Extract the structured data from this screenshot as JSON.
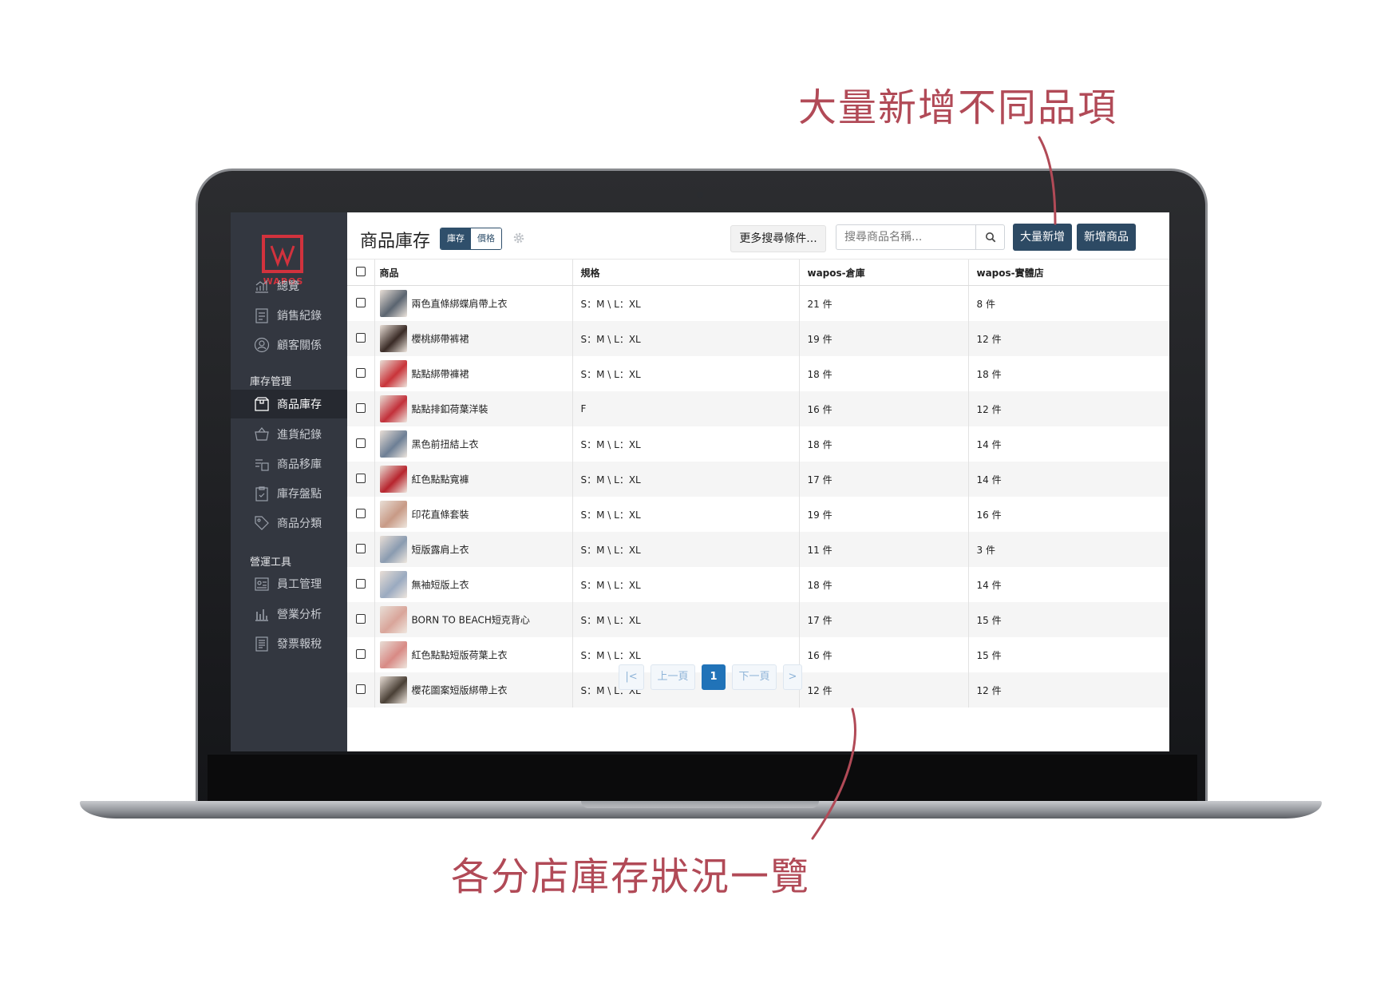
{
  "annotations": {
    "top": "大量新增不同品項",
    "bottom": "各分店庫存狀況一覽"
  },
  "sidebar": {
    "logo_text": "WAPOS",
    "items_top": [
      {
        "label": "總覽",
        "icon": "chart-icon"
      },
      {
        "label": "銷售紀錄",
        "icon": "receipt-icon"
      },
      {
        "label": "顧客關係",
        "icon": "customer-icon"
      }
    ],
    "section_inventory": "庫存管理",
    "items_inventory": [
      {
        "label": "商品庫存",
        "icon": "box-icon",
        "active": true
      },
      {
        "label": "進貨紀錄",
        "icon": "cart-icon"
      },
      {
        "label": "商品移庫",
        "icon": "transfer-icon"
      },
      {
        "label": "庫存盤點",
        "icon": "clipboard-icon"
      },
      {
        "label": "商品分類",
        "icon": "tag-icon"
      }
    ],
    "section_tools": "營運工具",
    "items_tools": [
      {
        "label": "員工管理",
        "icon": "employee-icon"
      },
      {
        "label": "營業分析",
        "icon": "bar-chart-icon"
      },
      {
        "label": "發票報稅",
        "icon": "invoice-icon"
      }
    ]
  },
  "header": {
    "title": "商品庫存",
    "toggle_on": "庫存",
    "toggle_off": "價格",
    "more_filters": "更多搜尋條件...",
    "search_placeholder": "搜尋商品名稱...",
    "bulk_add": "大量新增",
    "add_product": "新增商品"
  },
  "table": {
    "columns": [
      "商品",
      "規格",
      "wapos-倉庫",
      "wapos-實體店"
    ],
    "rows": [
      {
        "name": "兩色直條綁蝶肩帶上衣",
        "spec": "S：M \\ L：XL",
        "warehouse": "21 件",
        "store": "8 件",
        "thumb": "#5a6470"
      },
      {
        "name": "櫻桃綁帶裤裙",
        "spec": "S：M \\ L：XL",
        "warehouse": "19 件",
        "store": "12 件",
        "thumb": "#3a2b26"
      },
      {
        "name": "點點綁帶褲裙",
        "spec": "S：M \\ L：XL",
        "warehouse": "18 件",
        "store": "18 件",
        "thumb": "#c9343a"
      },
      {
        "name": "點點排釦荷葉洋裝",
        "spec": "F",
        "warehouse": "16 件",
        "store": "12 件",
        "thumb": "#c2303a"
      },
      {
        "name": "黑色前扭結上衣",
        "spec": "S：M \\ L：XL",
        "warehouse": "18 件",
        "store": "14 件",
        "thumb": "#6d7f95"
      },
      {
        "name": "紅色點點寬褲",
        "spec": "S：M \\ L：XL",
        "warehouse": "17 件",
        "store": "14 件",
        "thumb": "#b7252e"
      },
      {
        "name": "印花直條套裝",
        "spec": "S：M \\ L：XL",
        "warehouse": "19 件",
        "store": "16 件",
        "thumb": "#c89a86"
      },
      {
        "name": "短版露肩上衣",
        "spec": "S：M \\ L：XL",
        "warehouse": "11 件",
        "store": "3 件",
        "thumb": "#8a9bb0"
      },
      {
        "name": "無袖短版上衣",
        "spec": "S：M \\ L：XL",
        "warehouse": "18 件",
        "store": "14 件",
        "thumb": "#9aaac0"
      },
      {
        "name": "BORN TO BEACH短克背心",
        "spec": "S：M \\ L：XL",
        "warehouse": "17 件",
        "store": "15 件",
        "thumb": "#d9a59a"
      },
      {
        "name": "紅色點點短版荷葉上衣",
        "spec": "S：M \\ L：XL",
        "warehouse": "16 件",
        "store": "15 件",
        "thumb": "#d88a85"
      },
      {
        "name": "櫻花圖案短版綁帶上衣",
        "spec": "S：M \\ L：XL",
        "warehouse": "12 件",
        "store": "12 件",
        "thumb": "#4a4036"
      }
    ]
  },
  "pagination": {
    "first": "|<",
    "prev": "上一頁",
    "current": "1",
    "next": "下一頁",
    "last": ">"
  },
  "colors": {
    "accent": "#2d4a64",
    "annotation": "#b14a57",
    "sidebar_bg": "#333740",
    "logo_red": "#d2323d",
    "page_current": "#2173b8"
  }
}
